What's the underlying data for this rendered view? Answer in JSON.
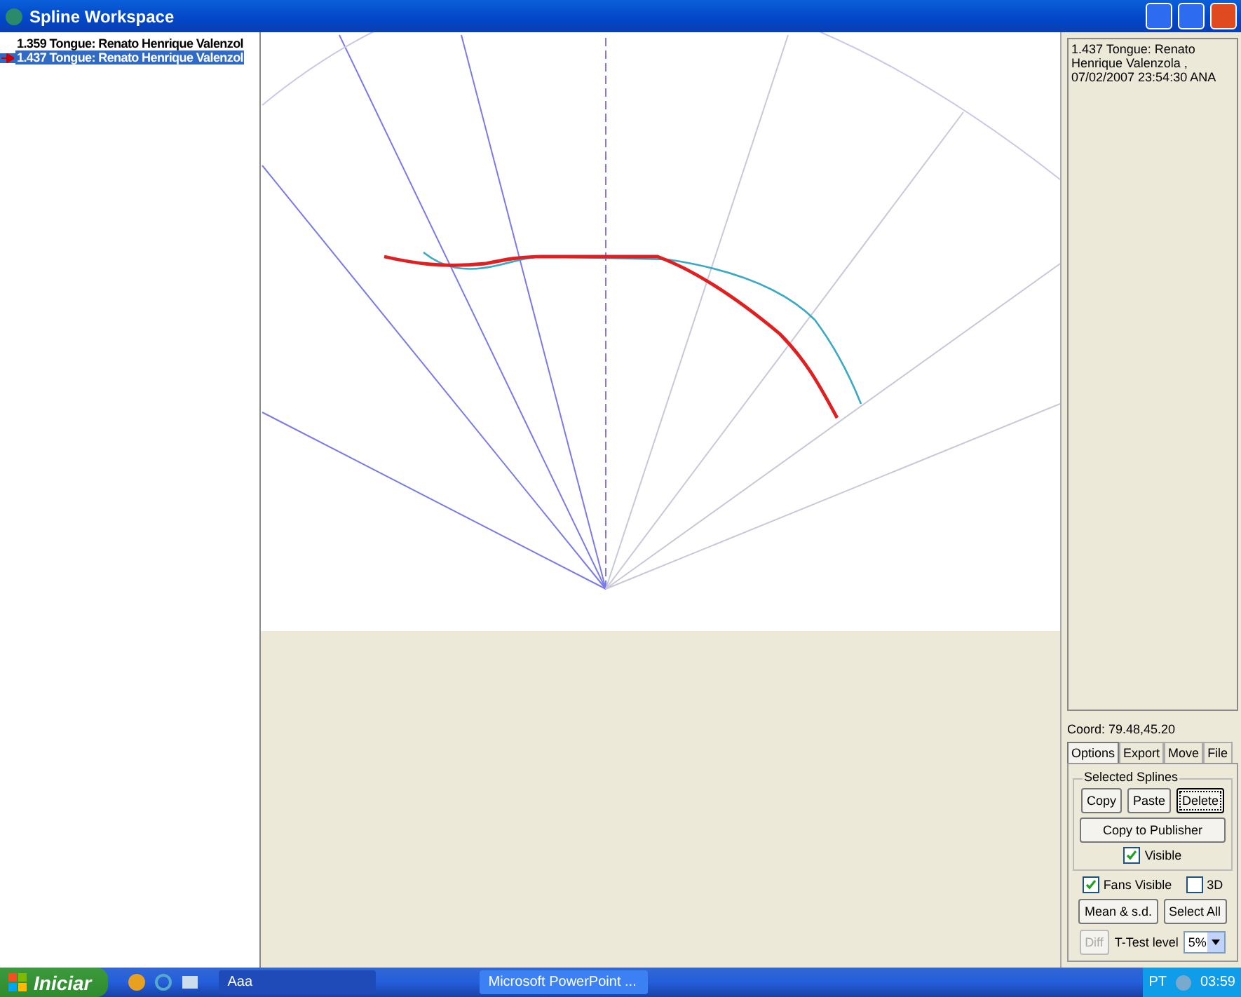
{
  "window": {
    "title": "Spline Workspace"
  },
  "splines": [
    {
      "label": "1.359 Tongue: Renato Henrique Valenzol",
      "selected": false,
      "current": false
    },
    {
      "label": "1.437 Tongue: Renato Henrique Valenzol",
      "selected": true,
      "current": true
    }
  ],
  "info": {
    "text": "1.437 Tongue: Renato Henrique Valenzola ,  07/02/2007 23:54:30 ANA"
  },
  "coord": "Coord: 79.48,45.20",
  "tabs": [
    {
      "label": "Options",
      "selected": true
    },
    {
      "label": "Export",
      "selected": false
    },
    {
      "label": "Move",
      "selected": false
    },
    {
      "label": "File",
      "selected": false
    }
  ],
  "selected_splines": {
    "title": "Selected Splines",
    "buttons": [
      {
        "label": "Copy",
        "focused": false
      },
      {
        "label": "Paste",
        "focused": false
      },
      {
        "label": "Delete",
        "focused": true
      }
    ],
    "publish_button": "Copy to Publisher",
    "visible": {
      "label": "Visible",
      "checked": true
    }
  },
  "fans_visible": {
    "label": "Fans Visible",
    "checked": true
  },
  "three_d": {
    "label": "3D",
    "checked": false
  },
  "mean_button": "Mean & s.d.",
  "select_all_button": "Select All",
  "diff_button": {
    "label": "Diff",
    "disabled": true
  },
  "t_test": {
    "label": "T-Test level",
    "value": "5%"
  },
  "taskbar": {
    "start": "Iniciar",
    "tasks": [
      {
        "label": "Aaa",
        "selected": true
      },
      {
        "label": "Microsoft PowerPoint ...",
        "selected": false
      }
    ],
    "language": "PT",
    "clock": "03:59"
  }
}
